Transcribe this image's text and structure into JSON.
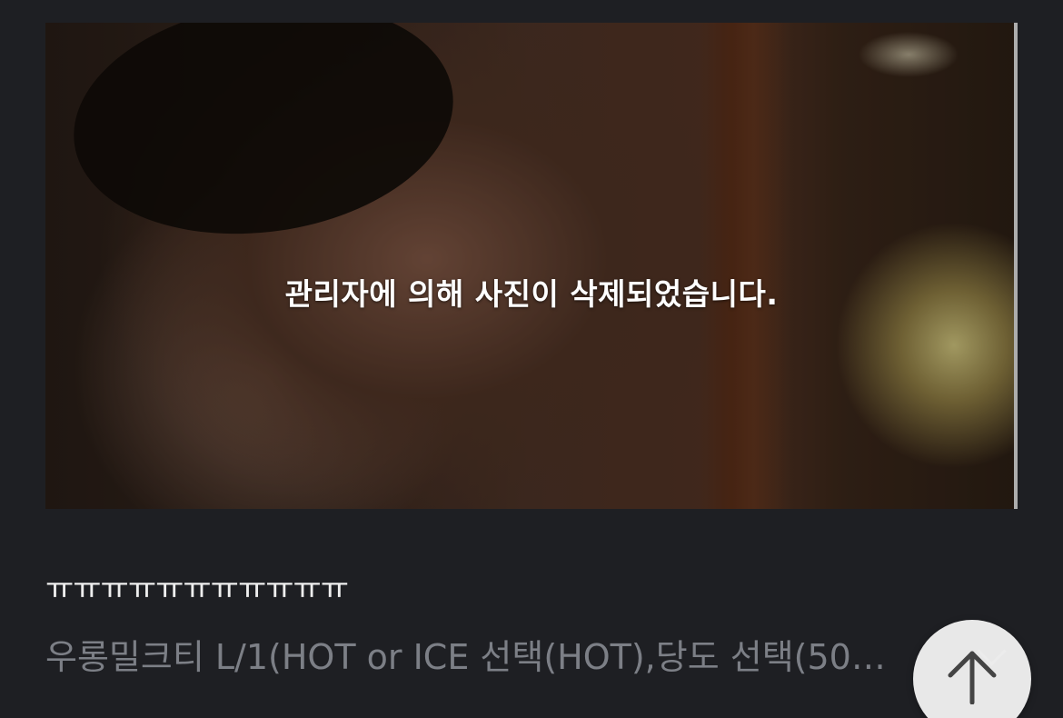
{
  "media": {
    "deleted_notice": "관리자에 의해 사진이 삭제되었습니다."
  },
  "post": {
    "title": "ㅠㅠㅠㅠㅠㅠㅠㅠㅠㅠㅠ",
    "menu_item": "우롱밀크티 L/1(HOT or ICE 선택(HOT),당도 선택(50…"
  },
  "icons": {
    "scroll_top": "arrow-up-icon",
    "expand": "chevron-down-icon"
  },
  "colors": {
    "background": "#1e1f23",
    "title_text": "#eeeeee",
    "muted_text": "#7c7f86",
    "fab_background": "#f0f0f0",
    "fab_icon": "#444444"
  }
}
